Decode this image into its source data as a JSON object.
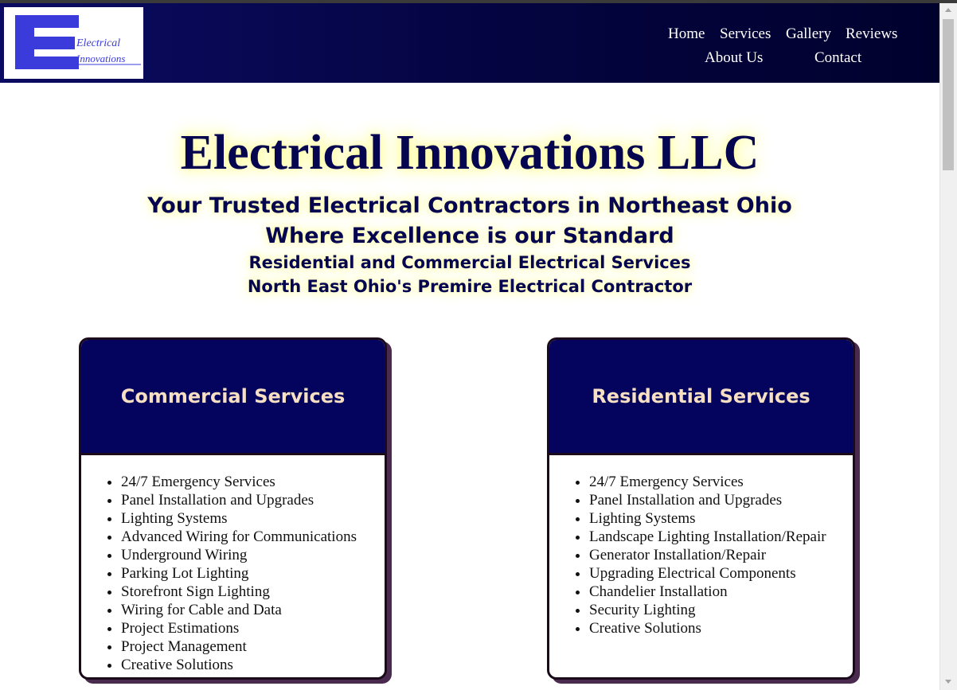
{
  "brand": {
    "logo_mark": "EI",
    "logo_text_line1": "Electrical",
    "logo_text_line2": "Innovations"
  },
  "nav": {
    "home": "Home",
    "services": "Services",
    "gallery": "Gallery",
    "reviews": "Reviews",
    "about": "About Us",
    "contact": "Contact"
  },
  "hero": {
    "title": "Electrical Innovations LLC",
    "tagline1": "Your Trusted Electrical Contractors in Northeast Ohio",
    "tagline2": "Where Excellence is our Standard",
    "tagline3": "Residential and Commercial Electrical Services",
    "tagline4": "North East Ohio's Premire Electrical Contractor"
  },
  "commercial": {
    "title": "Commercial Services",
    "items": [
      "24/7 Emergency Services",
      "Panel Installation and Upgrades",
      "Lighting Systems",
      "Advanced Wiring for Communications",
      "Underground Wiring",
      "Parking Lot Lighting",
      "Storefront Sign Lighting",
      "Wiring for Cable and Data",
      "Project Estimations",
      "Project Management",
      "Creative Solutions"
    ]
  },
  "residential": {
    "title": "Residential Services",
    "items": [
      "24/7 Emergency Services",
      "Panel Installation and Upgrades",
      "Lighting Systems",
      "Landscape Lighting Installation/Repair",
      "Generator Installation/Repair",
      "Upgrading Electrical Components",
      "Chandelier Installation",
      "Security Lighting",
      "Creative Solutions"
    ]
  },
  "colors": {
    "header_bg": "#040440",
    "title_text": "#060650",
    "card_head_bg": "#04045e",
    "card_head_text": "#f6dfc2",
    "glow": "#ffff99"
  }
}
